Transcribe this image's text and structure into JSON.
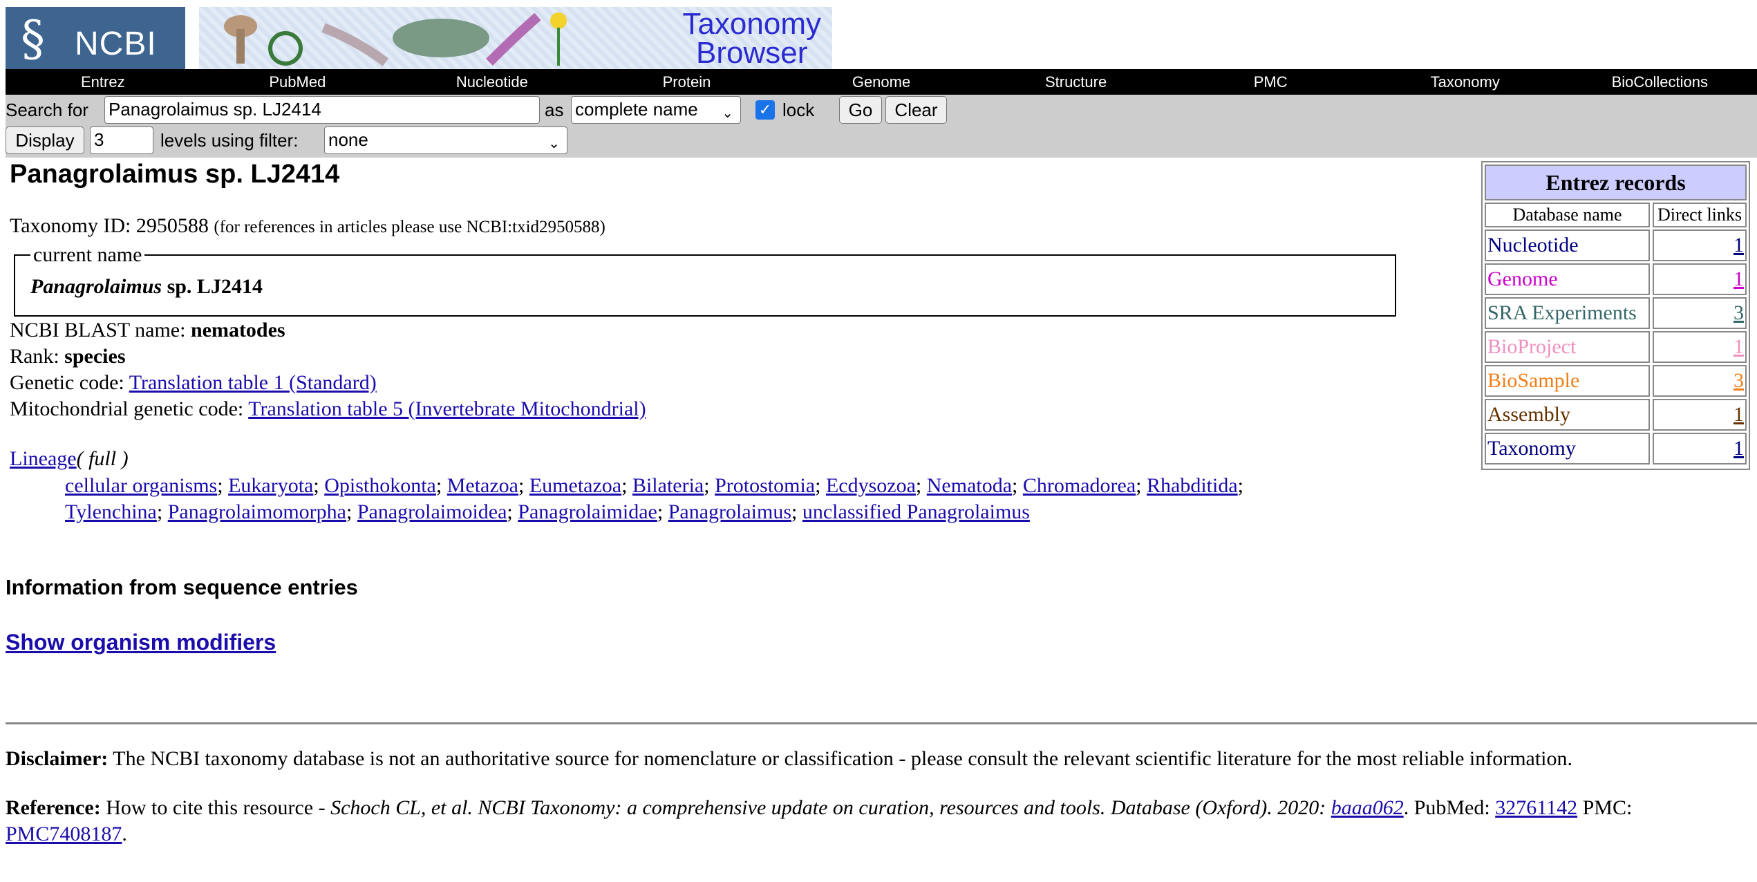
{
  "header": {
    "logo_text": "NCBI",
    "title_line1": "Taxonomy",
    "title_line2": "Browser"
  },
  "nav": [
    "Entrez",
    "PubMed",
    "Nucleotide",
    "Protein",
    "Genome",
    "Structure",
    "PMC",
    "Taxonomy",
    "BioCollections"
  ],
  "search": {
    "label": "Search for",
    "value": "Panagrolaimus sp. LJ2414",
    "as_label": "as",
    "as_selected": "complete name",
    "lock_label": "lock",
    "lock_checked": true,
    "go_label": "Go",
    "clear_label": "Clear",
    "display_label": "Display",
    "levels_value": "3",
    "levels_label": "levels using filter:",
    "filter_selected": "none"
  },
  "main": {
    "title": "Panagrolaimus sp. LJ2414",
    "taxid_label": "Taxonomy ID: 2950588",
    "taxid_ref": "(for references in articles please use NCBI:txid2950588)",
    "current_name_legend": "current name",
    "current_name_genus": "Panagrolaimus",
    "current_name_rest": " sp. LJ2414",
    "blast_label": "NCBI BLAST name: ",
    "blast_value": "nematodes",
    "rank_label": "Rank: ",
    "rank_value": "species",
    "genetic_label": "Genetic code: ",
    "genetic_link": "Translation table 1 (Standard)",
    "mito_label": "Mitochondrial genetic code: ",
    "mito_link": "Translation table 5 (Invertebrate Mitochondrial)",
    "lineage_link": "Lineage",
    "lineage_full": "( full )",
    "lineage": [
      "cellular organisms",
      "Eukaryota",
      "Opisthokonta",
      "Metazoa",
      "Eumetazoa",
      "Bilateria",
      "Protostomia",
      "Ecdysozoa",
      "Nematoda",
      "Chromadorea",
      "Rhabditida",
      "Tylenchina",
      "Panagrolaimomorpha",
      "Panagrolaimoidea",
      "Panagrolaimidae",
      "Panagrolaimus",
      "unclassified Panagrolaimus"
    ],
    "seq_heading": "Information from sequence entries",
    "modifiers_link": "Show organism modifiers"
  },
  "entrez": {
    "title": "Entrez records",
    "col_db": "Database name",
    "col_links": "Direct links",
    "rows": [
      {
        "name": "Nucleotide",
        "count": "1",
        "color": "#000080"
      },
      {
        "name": "Genome",
        "count": "1",
        "color": "#cc00cc"
      },
      {
        "name": "SRA Experiments",
        "count": "3",
        "color": "#336666"
      },
      {
        "name": "BioProject",
        "count": "1",
        "color": "#f08fbf"
      },
      {
        "name": "BioSample",
        "count": "3",
        "color": "#f07f1a"
      },
      {
        "name": "Assembly",
        "count": "1",
        "color": "#663300"
      },
      {
        "name": "Taxonomy",
        "count": "1",
        "color": "#000080"
      }
    ]
  },
  "footer": {
    "disclaimer_label": "Disclaimer:",
    "disclaimer_text": " The NCBI taxonomy database is not an authoritative source for nomenclature or classification - please consult the relevant scientific literature for the most reliable information.",
    "reference_label": "Reference:",
    "reference_text": " How to cite this resource - ",
    "reference_citation": "Schoch CL, et al. NCBI Taxonomy: a comprehensive update on curation, resources and tools. Database (Oxford). 2020: ",
    "reference_doi": "baaa062",
    "reference_pubmed_label": ". PubMed: ",
    "reference_pubmed": "32761142",
    "reference_pmc_label": " PMC: ",
    "reference_pmc": "PMC7408187",
    "reference_end": "."
  }
}
